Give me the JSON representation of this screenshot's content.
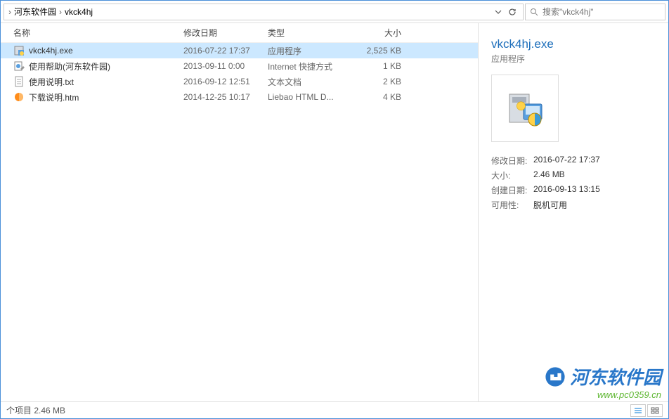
{
  "breadcrumb": {
    "item1": "河东软件园",
    "item2": "vkck4hj"
  },
  "search": {
    "placeholder": "搜索\"vkck4hj\""
  },
  "columns": {
    "name": "名称",
    "date": "修改日期",
    "type": "类型",
    "size": "大小"
  },
  "files": [
    {
      "name": "vkck4hj.exe",
      "date": "2016-07-22 17:37",
      "type": "应用程序",
      "size": "2,525 KB",
      "icon": "exe"
    },
    {
      "name": "使用帮助(河东软件园)",
      "date": "2013-09-11 0:00",
      "type": "Internet 快捷方式",
      "size": "1 KB",
      "icon": "url"
    },
    {
      "name": "使用说明.txt",
      "date": "2016-09-12 12:51",
      "type": "文本文档",
      "size": "2 KB",
      "icon": "txt"
    },
    {
      "name": "下载说明.htm",
      "date": "2014-12-25 10:17",
      "type": "Liebao HTML D...",
      "size": "4 KB",
      "icon": "htm"
    }
  ],
  "preview": {
    "title": "vkck4hj.exe",
    "subtitle": "应用程序",
    "meta": [
      {
        "label": "修改日期:",
        "value": "2016-07-22 17:37"
      },
      {
        "label": "大小:",
        "value": "2.46 MB"
      },
      {
        "label": "创建日期:",
        "value": "2016-09-13 13:15"
      },
      {
        "label": "可用性:",
        "value": "脱机可用"
      }
    ]
  },
  "status": {
    "text": "个项目  2.46 MB"
  },
  "watermark": {
    "title": "河东软件园",
    "url": "www.pc0359.cn"
  }
}
